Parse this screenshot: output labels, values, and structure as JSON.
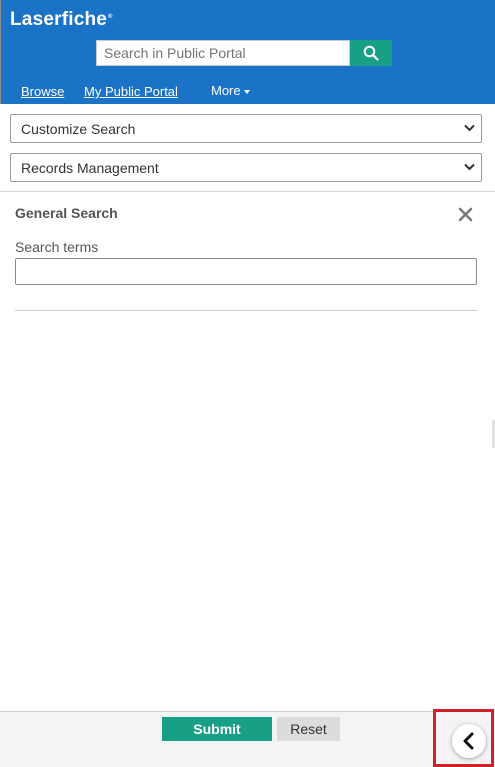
{
  "header": {
    "logo": "Laserfiche",
    "logo_mark": "®",
    "search": {
      "placeholder": "Search in Public Portal",
      "icon": "search-icon"
    },
    "nav": {
      "browse": "Browse",
      "my_portal": "My Public Portal",
      "more": "More"
    }
  },
  "form": {
    "search_type": "Customize Search",
    "repository": "Records Management",
    "section_title": "General Search",
    "search_terms_label": "Search terms",
    "search_terms_value": ""
  },
  "footer": {
    "submit": "Submit",
    "reset": "Reset",
    "collapse_icon": "chevron-left-icon"
  },
  "colors": {
    "header_bg": "#1a73c7",
    "accent_green": "#17a085",
    "highlight_red": "#d0202a"
  }
}
